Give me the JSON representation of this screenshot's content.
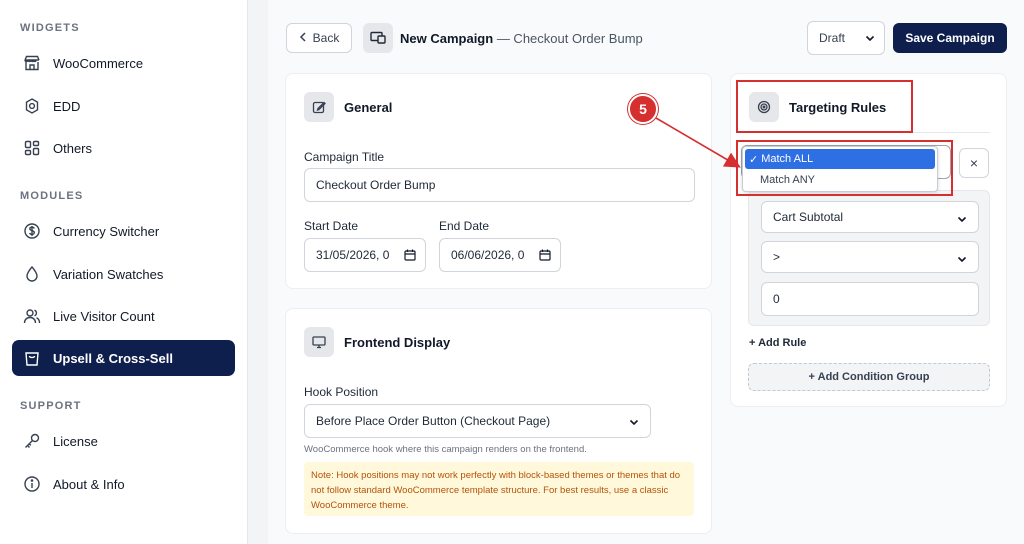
{
  "sidebar": {
    "widgets_heading": "WIDGETS",
    "modules_heading": "MODULES",
    "support_heading": "SUPPORT",
    "items": [
      {
        "label": "WooCommerce",
        "icon": "store-icon"
      },
      {
        "label": "EDD",
        "icon": "gear-icon"
      },
      {
        "label": "Others",
        "icon": "grid-icon"
      },
      {
        "label": "Currency Switcher",
        "icon": "dollar-icon"
      },
      {
        "label": "Variation Swatches",
        "icon": "droplet-icon"
      },
      {
        "label": "Live Visitor Count",
        "icon": "users-icon"
      },
      {
        "label": "Upsell & Cross-Sell",
        "icon": "bag-icon",
        "active": true
      },
      {
        "label": "License",
        "icon": "key-icon"
      },
      {
        "label": "About & Info",
        "icon": "info-icon"
      }
    ]
  },
  "header": {
    "back_label": "Back",
    "title": "New Campaign",
    "subtitle": "— Checkout Order Bump",
    "status_value": "Draft",
    "save_label": "Save Campaign"
  },
  "general": {
    "title": "General",
    "campaign_title_label": "Campaign Title",
    "campaign_title_value": "Checkout Order Bump",
    "start_date_label": "Start Date",
    "start_date_value": "31/05/2026, 0",
    "end_date_label": "End Date",
    "end_date_value": "06/06/2026, 0"
  },
  "frontend": {
    "title": "Frontend Display",
    "hook_label": "Hook Position",
    "hook_value": "Before Place Order Button (Checkout Page)",
    "hint": "WooCommerce hook where this campaign renders on the frontend.",
    "note": "Note: Hook positions may not work perfectly with block-based themes or themes that do not follow standard WooCommerce template structure. For best results, use a classic WooCommerce theme."
  },
  "targeting": {
    "title": "Targeting Rules",
    "match_options": [
      "Match ALL",
      "Match ANY"
    ],
    "selected_match": "Match ALL",
    "check_mark": "✓",
    "rule_field": "Cart Subtotal",
    "rule_operator": ">",
    "rule_value": "0",
    "add_rule_label": "+ Add Rule",
    "add_group_label": "+ Add Condition Group",
    "remove_symbol": "×"
  },
  "annotation": {
    "step_number": "5"
  },
  "colors": {
    "accent": "#0f1f4d",
    "highlight": "#d62f2f",
    "select_blue": "#2f6fe4"
  }
}
